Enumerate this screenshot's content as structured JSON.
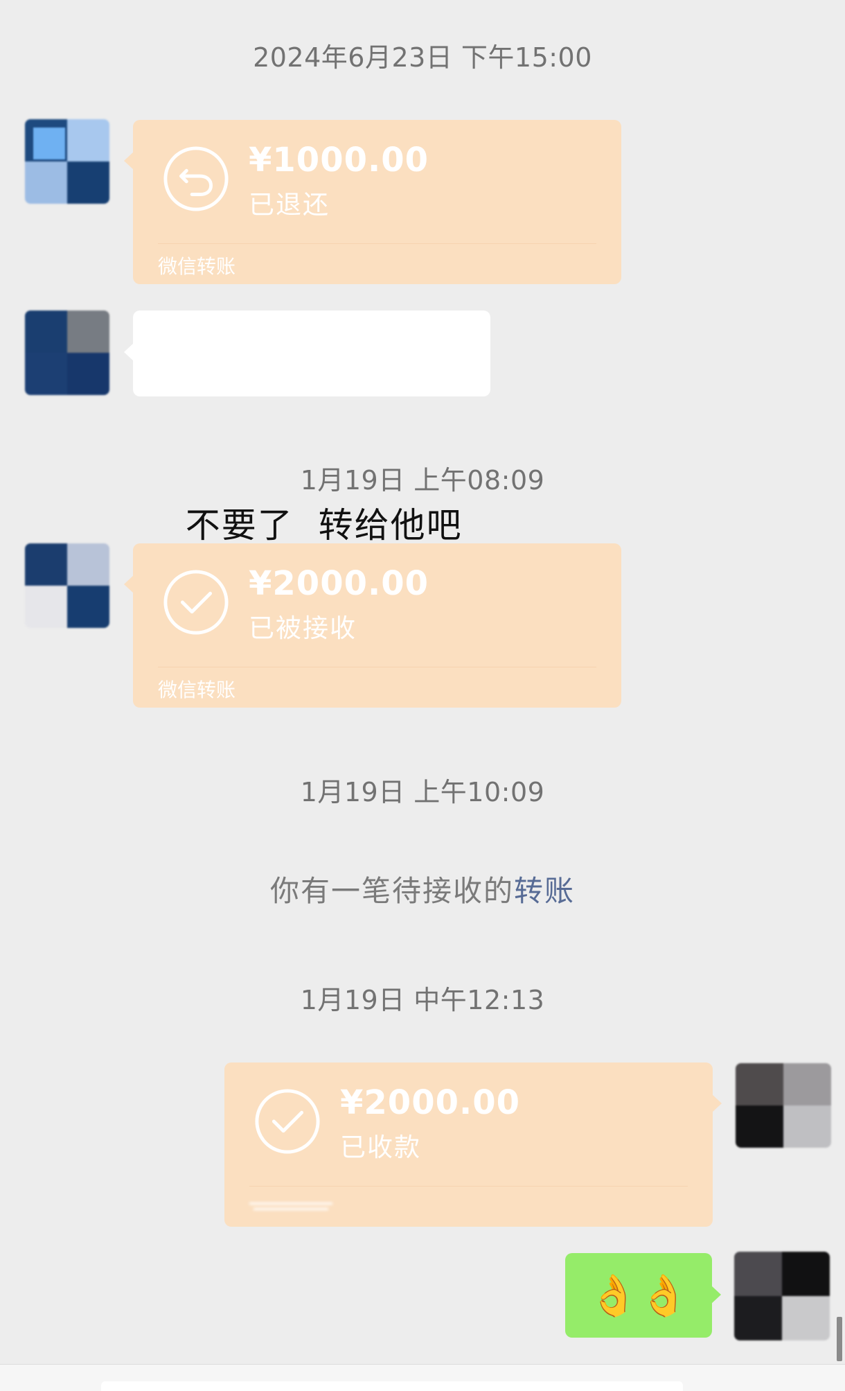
{
  "timestamps": {
    "t1": "2024年6月23日 下午15:00",
    "t2": "1月19日 上午08:09",
    "t3": "1月19日 上午10:09",
    "t4": "1月19日 中午12:13"
  },
  "messages": {
    "transfer1": {
      "amount": "¥1000.00",
      "status": "已退还",
      "label": "微信转账",
      "icon": "return-arrow-icon"
    },
    "text1": "不要了  转给他吧",
    "transfer2": {
      "amount": "¥2000.00",
      "status": "已被接收",
      "label": "微信转账",
      "icon": "check-icon"
    },
    "notice": {
      "text": "你有一笔待接收的",
      "link": "转账"
    },
    "transfer3": {
      "amount": "¥2000.00",
      "status": "已收款",
      "icon": "check-icon"
    },
    "emoji_message": "👌👌"
  },
  "colors": {
    "background": "#ededed",
    "transfer_bubble": "#fbdfc0",
    "sent_bubble": "#95ec69",
    "link": "#576b95"
  }
}
